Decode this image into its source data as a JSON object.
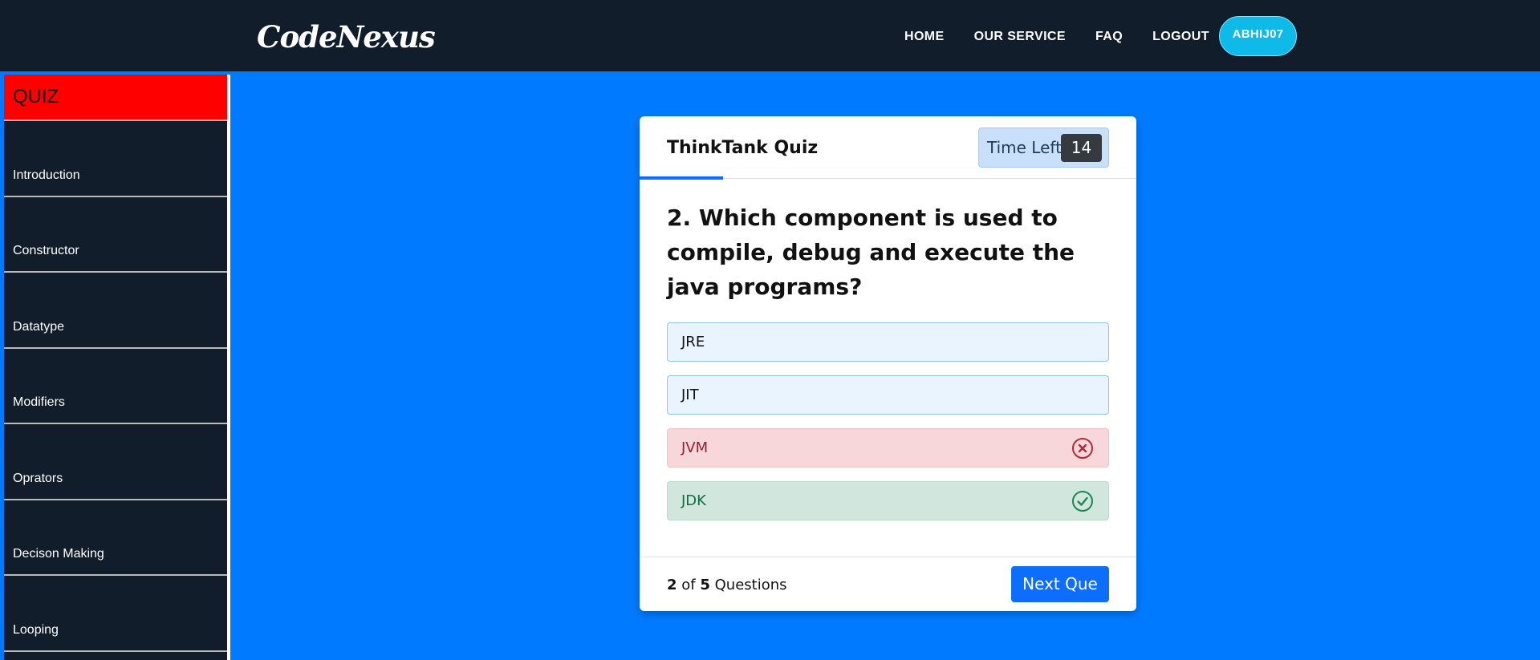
{
  "brand": "CodeNexus",
  "nav": {
    "items": [
      "HOME",
      "OUR SERVICE",
      "FAQ",
      "LOGOUT"
    ],
    "user": "ABHIJ07"
  },
  "sidebar": {
    "title": "QUIZ",
    "items": [
      "Introduction",
      "Constructor",
      "Datatype",
      "Modifiers",
      "Oprators",
      "Decison Making",
      "Looping"
    ]
  },
  "quiz": {
    "title": "ThinkTank Quiz",
    "time_label": "Time Left",
    "time_value": "14",
    "question": "2. Which component is used to compile, debug and execute the java programs?",
    "options": [
      {
        "label": "JRE",
        "state": "neutral"
      },
      {
        "label": "JIT",
        "state": "neutral"
      },
      {
        "label": "JVM",
        "state": "wrong",
        "icon": "x-circle-icon"
      },
      {
        "label": "JDK",
        "state": "correct",
        "icon": "check-circle-icon"
      }
    ],
    "footer": {
      "current": "2",
      "of_text": "of",
      "total": "5",
      "questions_text": "Questions",
      "next_label": "Next Que"
    }
  },
  "colors": {
    "page_bg": "#007bff",
    "nav_bg": "#121d2b",
    "sidebar_title_bg": "#ff0000",
    "wrong": "#9b1c2c",
    "correct": "#116d3e",
    "primary": "#0d6efd"
  }
}
